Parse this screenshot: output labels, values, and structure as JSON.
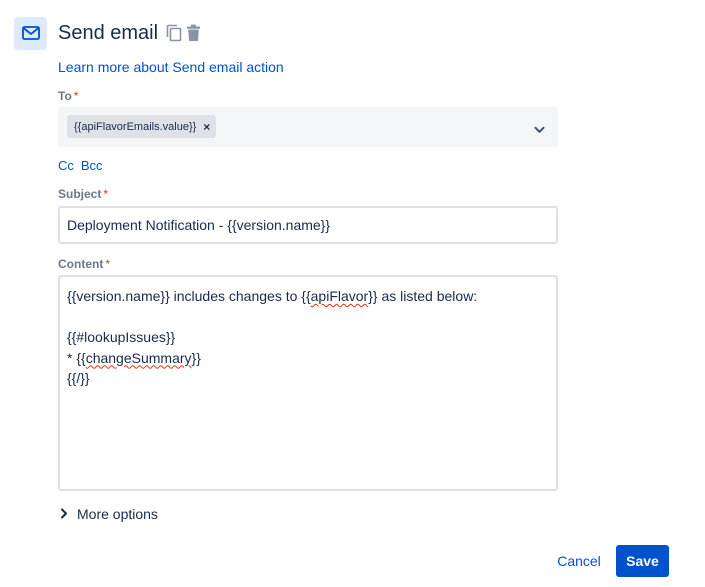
{
  "header": {
    "title": "Send email",
    "icon": "mail-icon",
    "accent": "#0052cc",
    "icon_bg": "#deebff"
  },
  "learn_more_link": "Learn more about Send email action",
  "to": {
    "label": "To",
    "required_mark": "*",
    "chip": "{{apiFlavorEmails.value}}",
    "chip_remove": "×"
  },
  "cc_label": "Cc",
  "bcc_label": "Bcc",
  "subject": {
    "label": "Subject",
    "required_mark": "*",
    "value": "Deployment Notification - {{version.name}}"
  },
  "content": {
    "label": "Content",
    "required_mark": "*",
    "lines": [
      "{{version.name}} includes changes to {{apiFlavor}} as listed below:",
      "",
      "{{#lookupIssues}}",
      "* {{changeSummary}}",
      "{{/}}"
    ]
  },
  "more_options": "More options",
  "footer": {
    "cancel": "Cancel",
    "save": "Save"
  }
}
